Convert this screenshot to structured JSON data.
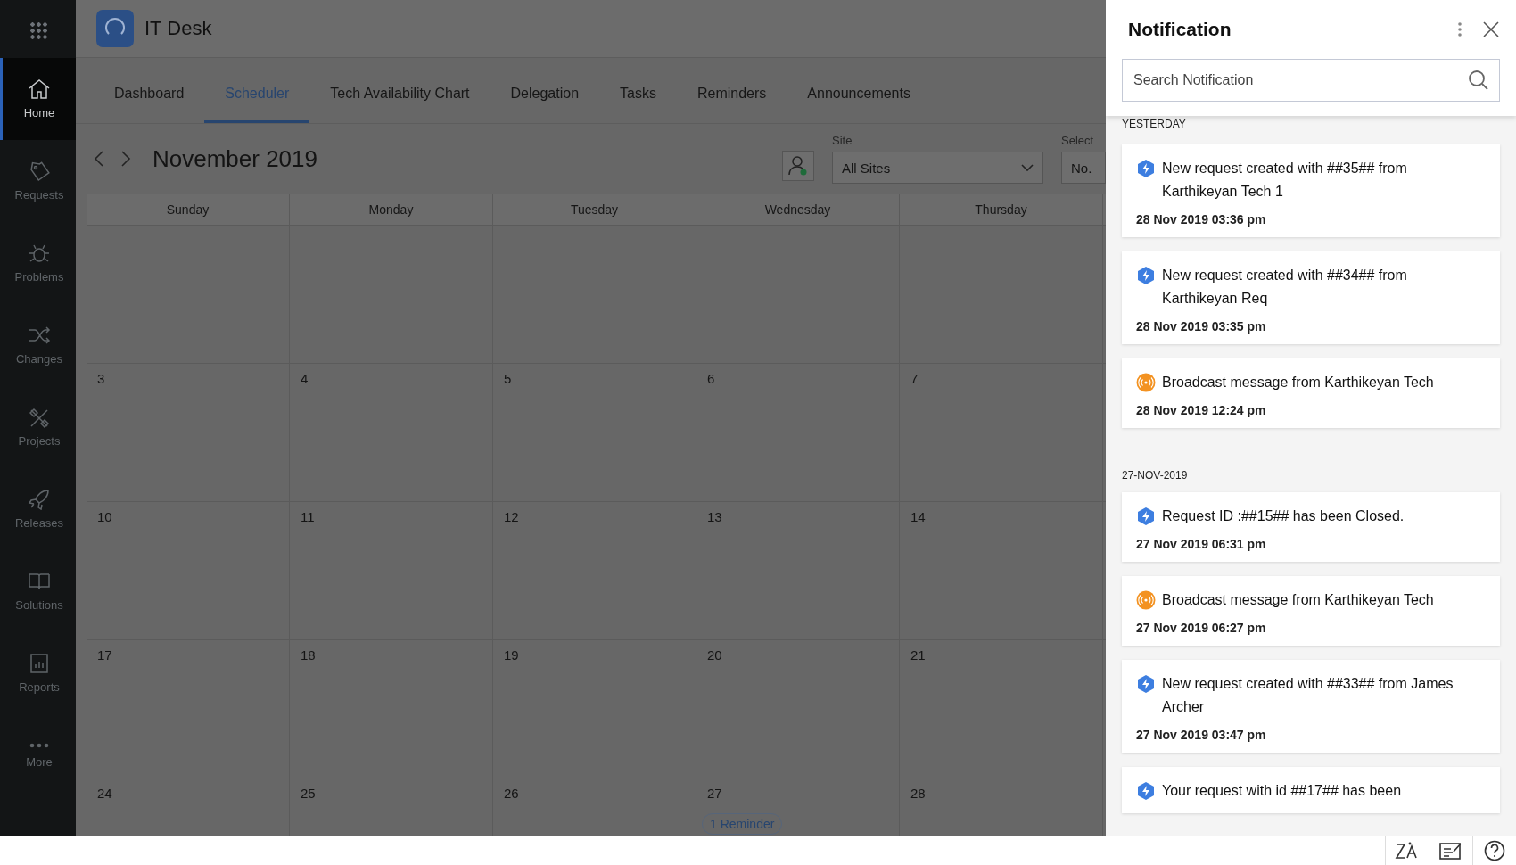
{
  "app": {
    "title": "IT Desk"
  },
  "sidebar": {
    "items": [
      {
        "label": "Home",
        "selected": true
      },
      {
        "label": "Requests",
        "selected": false
      },
      {
        "label": "Problems",
        "selected": false
      },
      {
        "label": "Changes",
        "selected": false
      },
      {
        "label": "Projects",
        "selected": false
      },
      {
        "label": "Releases",
        "selected": false
      },
      {
        "label": "Solutions",
        "selected": false
      },
      {
        "label": "Reports",
        "selected": false
      },
      {
        "label": "More",
        "selected": false
      }
    ]
  },
  "tabs": [
    {
      "label": "Dashboard",
      "selected": false
    },
    {
      "label": "Scheduler",
      "selected": true
    },
    {
      "label": "Tech Availability Chart",
      "selected": false
    },
    {
      "label": "Delegation",
      "selected": false
    },
    {
      "label": "Tasks",
      "selected": false
    },
    {
      "label": "Reminders",
      "selected": false
    },
    {
      "label": "Announcements",
      "selected": false
    }
  ],
  "calendar": {
    "month": "November 2019",
    "site": {
      "label": "Site",
      "value": "All Sites"
    },
    "select": {
      "label": "Select",
      "value": "No."
    },
    "weekdays": [
      "Sunday",
      "Monday",
      "Tuesday",
      "Wednesday",
      "Thursday"
    ],
    "weeks": [
      {
        "kind": "blank"
      },
      {
        "kind": "dates",
        "days": [
          {
            "date": "3"
          },
          {
            "date": "4"
          },
          {
            "date": "5"
          },
          {
            "date": "6"
          },
          {
            "date": "7"
          }
        ]
      },
      {
        "kind": "dates",
        "days": [
          {
            "date": "10"
          },
          {
            "date": "11"
          },
          {
            "date": "12"
          },
          {
            "date": "13"
          },
          {
            "date": "14"
          }
        ]
      },
      {
        "kind": "dates",
        "days": [
          {
            "date": "17"
          },
          {
            "date": "18"
          },
          {
            "date": "19"
          },
          {
            "date": "20"
          },
          {
            "date": "21"
          }
        ]
      },
      {
        "kind": "dates",
        "days": [
          {
            "date": "24"
          },
          {
            "date": "25"
          },
          {
            "date": "26"
          },
          {
            "date": "27",
            "badge": "1 Reminder"
          },
          {
            "date": "28"
          }
        ]
      }
    ]
  },
  "notification": {
    "title": "Notification",
    "search": {
      "placeholder": "Search Notification"
    },
    "groups": [
      {
        "heading": "YESTERDAY",
        "items": [
          {
            "kind": "request",
            "text": "New request created with ##35## from Karthikeyan Tech 1",
            "time": "28 Nov 2019 03:36 pm"
          },
          {
            "kind": "request",
            "text": "New request created with ##34## from Karthikeyan Req",
            "time": "28 Nov 2019 03:35 pm"
          },
          {
            "kind": "broadcast",
            "text": "Broadcast message from Karthikeyan Tech",
            "time": "28 Nov 2019 12:24 pm"
          }
        ]
      },
      {
        "heading": "27-NOV-2019",
        "items": [
          {
            "kind": "request",
            "text": "Request ID :##15## has been Closed.",
            "time": "27 Nov 2019 06:31 pm"
          },
          {
            "kind": "broadcast",
            "text": "Broadcast message from Karthikeyan Tech",
            "time": "27 Nov 2019 06:27 pm"
          },
          {
            "kind": "request",
            "text": "New request created with ##33## from James Archer",
            "time": "27 Nov 2019 03:47 pm"
          },
          {
            "kind": "request",
            "text": "Your request with id ##17## has been"
          }
        ]
      }
    ]
  }
}
